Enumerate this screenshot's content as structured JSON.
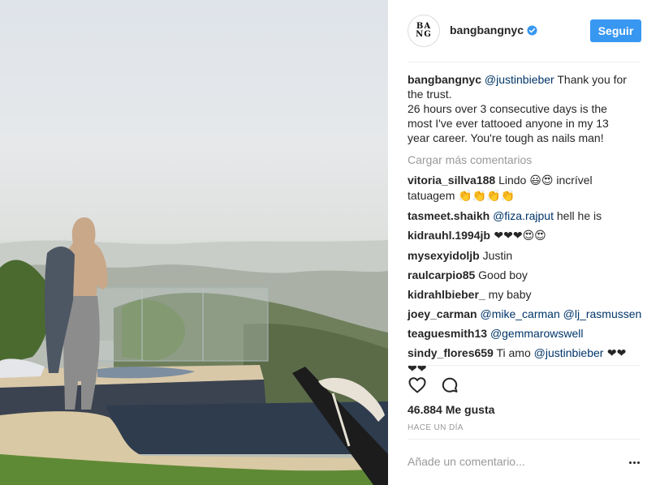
{
  "post": {
    "author": "bangbangnyc",
    "avatar_logo": "BANG",
    "verified": true,
    "follow_label": "Seguir",
    "photo_description_icon": "photo"
  },
  "caption": {
    "user": "bangbangnyc",
    "mention": "@justinbieber",
    "text_1": " Thank you for",
    "text_2": "the trust.",
    "text_3": "26 hours over 3 consecutive days is the",
    "text_4": "most I've ever tattooed anyone in my 13",
    "text_5": "year career. You're tough as nails man!"
  },
  "load_more": "Cargar más comentarios",
  "comments": [
    {
      "user": "vitoria_sillva188",
      "text_a": " Lindo ",
      "emoji_a": "😃😍",
      "text_b": " incrível",
      "text_c": "tatuagem ",
      "emoji_b": "👏👏👏👏"
    },
    {
      "user": "tasmeet.shaikh",
      "mention": "@fiza.rajput",
      "text": " hell he is"
    },
    {
      "user": "kidrauhl.1994jb",
      "emoji": " ❤❤❤😍😍"
    },
    {
      "user": "mysexyidoljb",
      "text": " Justin"
    },
    {
      "user": "raulcarpio85",
      "text": " Good boy"
    },
    {
      "user": "kidrahlbieber_",
      "text": " my baby"
    },
    {
      "user": "joey_carman",
      "mention": "@mike_carman",
      "mention2": "@lj_rasmussen"
    },
    {
      "user": "teaguesmith13",
      "mention": "@gemmarowswell"
    },
    {
      "user": "sindy_flores659",
      "text": " Ti amo ",
      "mention": "@justinbieber",
      "emoji": " ❤❤",
      "emoji2": "❤❤"
    }
  ],
  "likes": "46.884 Me gusta",
  "timestamp": "HACE UN DÍA",
  "add_comment": {
    "placeholder": "Añade un comentario..."
  },
  "colors": {
    "accent": "#3897f0",
    "mention": "#003569",
    "muted": "#999999"
  }
}
